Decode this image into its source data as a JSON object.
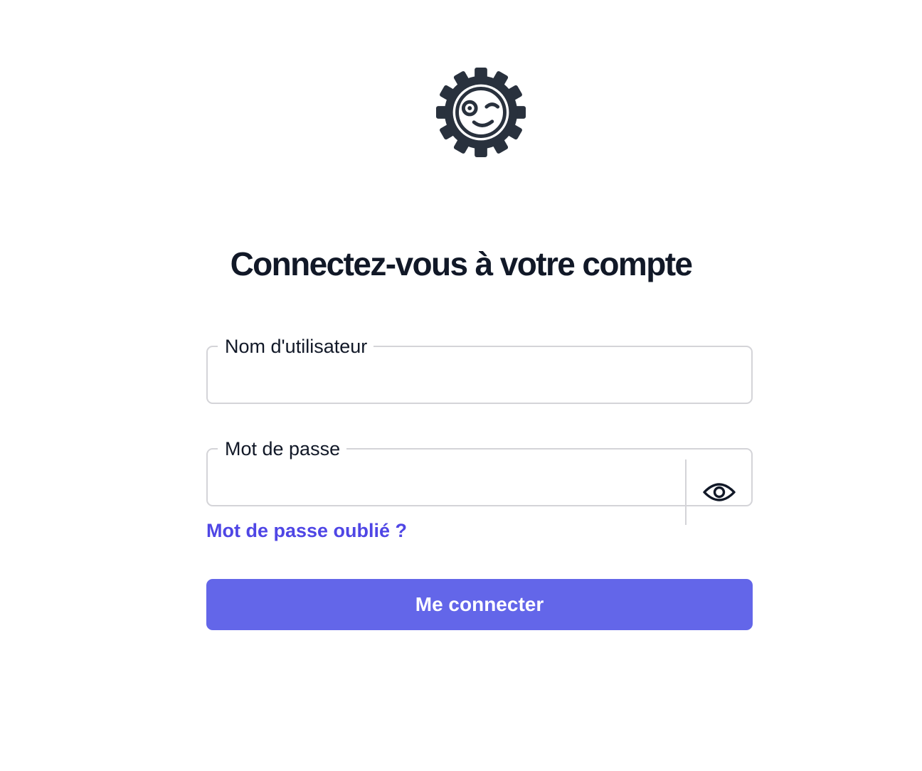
{
  "logo": {
    "icon": "gear-winking-face-icon",
    "color": "#29313d"
  },
  "heading": "Connectez-vous à votre compte",
  "form": {
    "username": {
      "label": "Nom d'utilisateur",
      "value": "",
      "placeholder": ""
    },
    "password": {
      "label": "Mot de passe",
      "value": "",
      "placeholder": "",
      "toggle_icon": "eye-icon"
    },
    "forgot_link": "Mot de passe oublié ?",
    "submit_label": "Me connecter"
  },
  "colors": {
    "accent": "#6366e9",
    "link": "#4f46e5",
    "text": "#111827",
    "border": "#d4d4d8"
  }
}
